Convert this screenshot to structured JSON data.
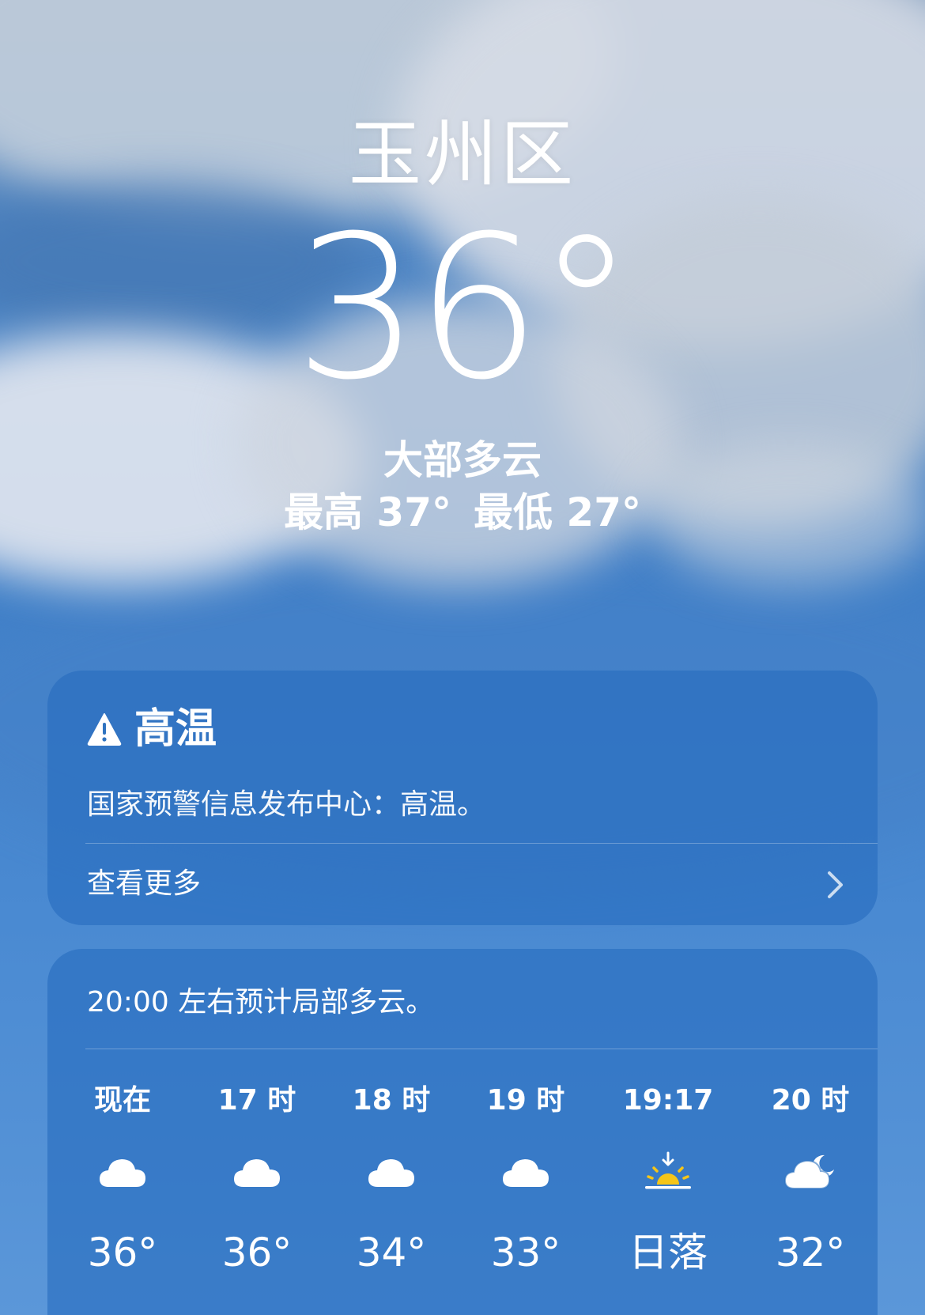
{
  "location": {
    "city": "玉州区",
    "temperature": "36°",
    "condition": "大部多云",
    "high": "最高 37°",
    "low": "最低 27°"
  },
  "alert": {
    "icon": "warning-triangle-icon",
    "title": "高温",
    "description": "国家预警信息发布中心：高温。",
    "more_label": "查看更多"
  },
  "forecast": {
    "summary": "20:00 左右预计局部多云。",
    "hours": [
      {
        "label": "现在",
        "icon": "cloud-icon",
        "value": "36°"
      },
      {
        "label": "17 时",
        "icon": "cloud-icon",
        "value": "36°"
      },
      {
        "label": "18 时",
        "icon": "cloud-icon",
        "value": "34°"
      },
      {
        "label": "19 时",
        "icon": "cloud-icon",
        "value": "33°"
      },
      {
        "label": "19:17",
        "icon": "sunset-icon",
        "value": "日落"
      },
      {
        "label": "20 时",
        "icon": "cloud-moon-icon",
        "value": "32°"
      }
    ]
  },
  "colors": {
    "sun": "#f5c518",
    "card": "#266cbe",
    "text": "#ffffff"
  }
}
